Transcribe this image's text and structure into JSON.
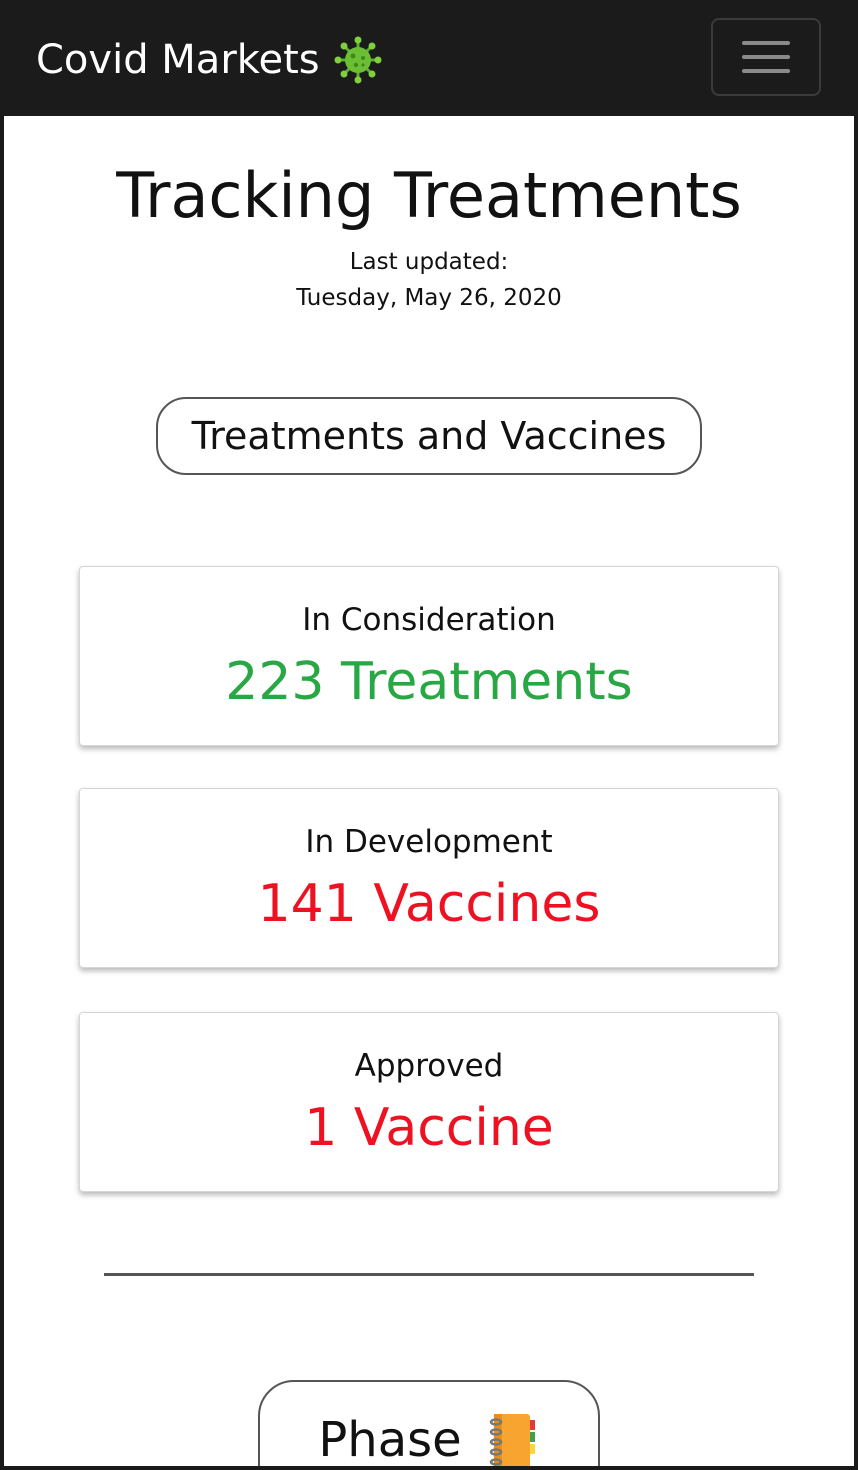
{
  "header": {
    "brand": "Covid Markets",
    "brand_icon": "virus-icon",
    "menu_icon": "hamburger-menu-icon",
    "background": "#1b1b1b"
  },
  "main": {
    "title": "Tracking Treatments",
    "updated_label": "Last updated:",
    "updated_date": "Tuesday, May 26, 2020",
    "filter_button": "Treatments and Vaccines",
    "cards": [
      {
        "label": "In Consideration",
        "value": "223 Treatments",
        "color": "#28a745"
      },
      {
        "label": "In Development",
        "value": "141 Vaccines",
        "color": "#ee1122"
      },
      {
        "label": "Approved",
        "value": "1 Vaccine",
        "color": "#ee1122"
      }
    ],
    "phase_button": "Phase",
    "phase_icon": "notebook-icon"
  }
}
